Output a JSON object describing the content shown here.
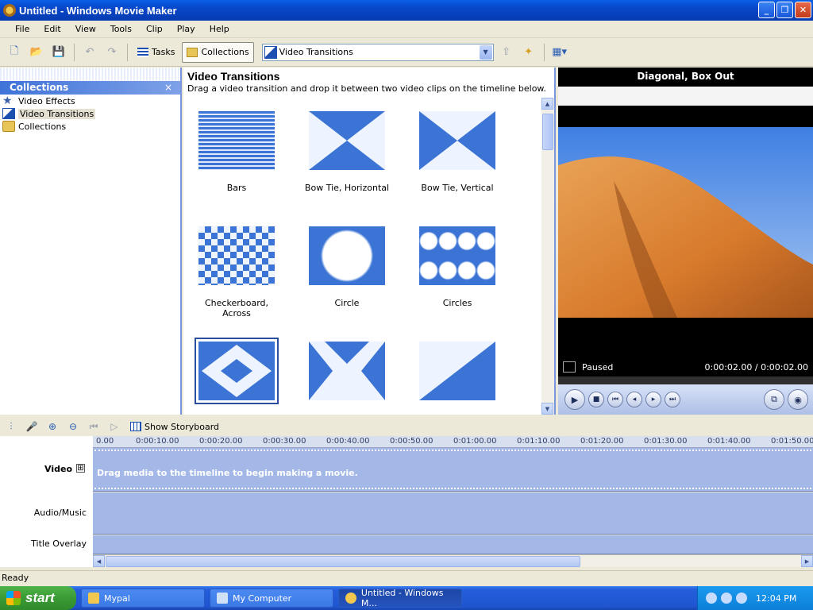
{
  "window": {
    "title": "Untitled - Windows Movie Maker"
  },
  "menu": [
    "File",
    "Edit",
    "View",
    "Tools",
    "Clip",
    "Play",
    "Help"
  ],
  "toolbar": {
    "tasks_label": "Tasks",
    "collections_label": "Collections",
    "location_value": "Video Transitions"
  },
  "collections_pane": {
    "title": "Collections",
    "close_glyph": "×",
    "items": [
      {
        "label": "Video Effects",
        "icon": "star-icon"
      },
      {
        "label": "Video Transitions",
        "icon": "transition-icon",
        "selected": true
      },
      {
        "label": "Collections",
        "icon": "collections-folder-icon"
      }
    ]
  },
  "transitions_pane": {
    "heading": "Video Transitions",
    "instruction": "Drag a video transition and drop it between two video clips on the timeline below.",
    "items": [
      {
        "label": "Bars"
      },
      {
        "label": "Bow Tie, Horizontal"
      },
      {
        "label": "Bow Tie, Vertical"
      },
      {
        "label": "Checkerboard, Across"
      },
      {
        "label": "Circle"
      },
      {
        "label": "Circles"
      },
      {
        "label": "",
        "selected": true
      },
      {
        "label": ""
      },
      {
        "label": ""
      }
    ]
  },
  "monitor": {
    "title": "Diagonal, Box Out",
    "status": "Paused",
    "time": "0:00:02.00 / 0:00:02.00"
  },
  "timeline_toolbar": {
    "storyboard_label": "Show Storyboard"
  },
  "timeline": {
    "ruler": [
      "0.00",
      "0:00:10.00",
      "0:00:20.00",
      "0:00:30.00",
      "0:00:40.00",
      "0:00:50.00",
      "0:01:00.00",
      "0:01:10.00",
      "0:01:20.00",
      "0:01:30.00",
      "0:01:40.00",
      "0:01:50.00"
    ],
    "tracks": {
      "video": "Video",
      "video_expand": "⊞",
      "audio": "Audio/Music",
      "overlay": "Title Overlay"
    },
    "placeholder": "Drag media to the timeline to begin making a movie."
  },
  "statusbar": {
    "text": "Ready"
  },
  "taskbar": {
    "start_label": "start",
    "tasks": [
      {
        "label": "Mypal"
      },
      {
        "label": "My Computer"
      },
      {
        "label": "Untitled - Windows M...",
        "active": true
      }
    ],
    "clock": "12:04 PM"
  },
  "colors": {
    "accent_blue": "#3f73d8",
    "track_blue": "#a4b8e8",
    "transition_blue": "#3b74d4"
  }
}
